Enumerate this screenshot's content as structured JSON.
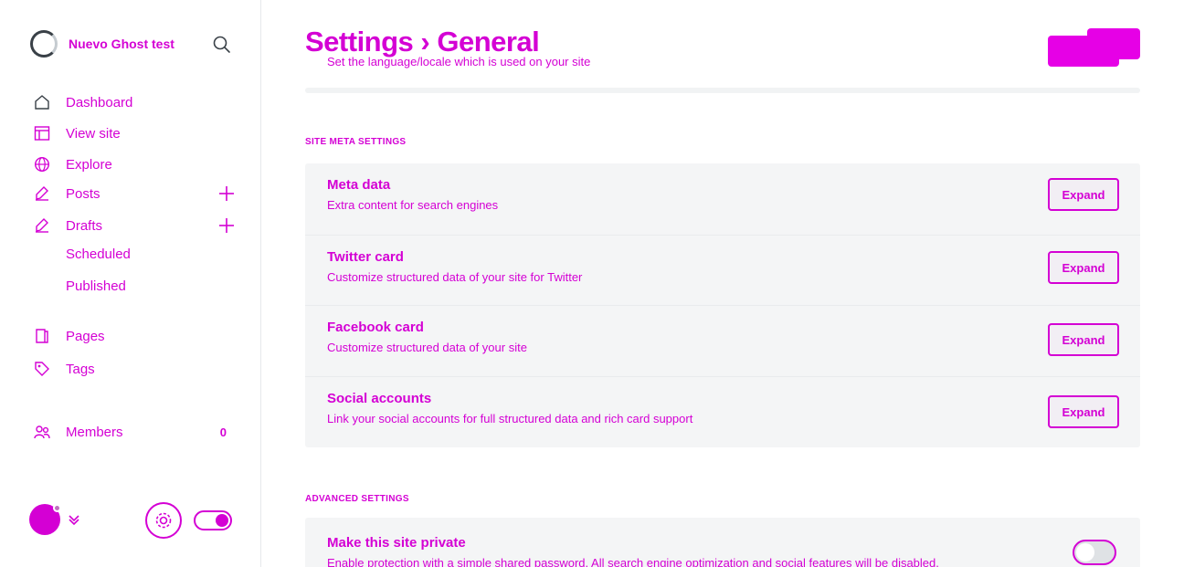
{
  "sidebar": {
    "site_title": "Nuevo Ghost test",
    "nav": {
      "dashboard": "Dashboard",
      "view_site": "View site",
      "explore": "Explore",
      "posts": "Posts",
      "drafts": "Drafts",
      "scheduled": "Scheduled",
      "published": "Published",
      "pages": "Pages",
      "tags": "Tags",
      "members": "Members",
      "members_count": "0"
    }
  },
  "main": {
    "title": "Settings › General",
    "language_desc": "Set the language/locale which is used on your site",
    "site_meta_label": "Site meta settings",
    "advanced_label": "Advanced settings",
    "expand_label": "Expand",
    "rows": [
      {
        "title": "Meta data",
        "desc": "Extra content for search engines"
      },
      {
        "title": "Twitter card",
        "desc": "Customize structured data of your site for Twitter"
      },
      {
        "title": "Facebook card",
        "desc": "Customize structured data of your site"
      },
      {
        "title": "Social accounts",
        "desc": "Link your social accounts for full structured data and rich card support"
      }
    ],
    "private": {
      "title": "Make this site private",
      "desc": "Enable protection with a simple shared password. All search engine optimization and social features will be disabled."
    }
  },
  "colors": {
    "accent": "#d400d4",
    "panel_bg": "#f4f5f6"
  }
}
